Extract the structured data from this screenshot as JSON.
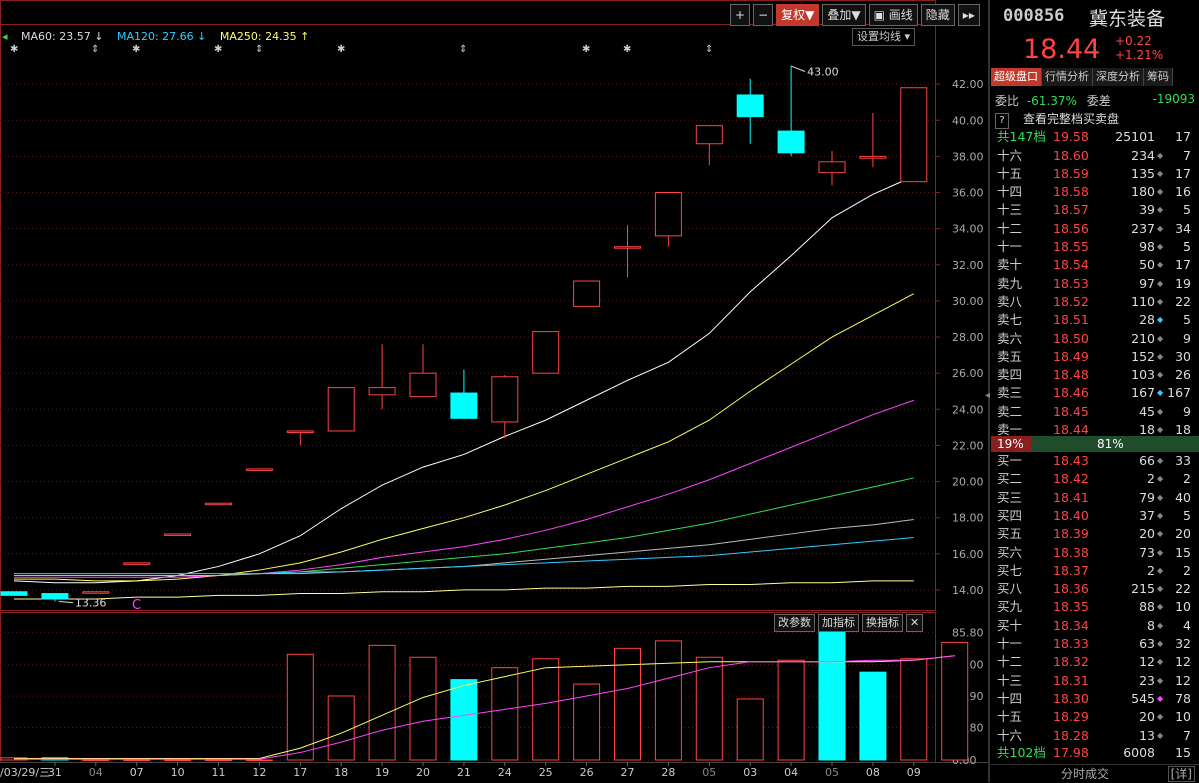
{
  "toolbar": {
    "plus": "+",
    "minus": "−",
    "fuquan": "复权▼",
    "diejia": "叠加▼",
    "draw": "画线",
    "hide": "隐藏",
    "expand": "▸▸"
  },
  "ma_legend": [
    {
      "label": "MA60: 23.57",
      "arrow": "↓",
      "color": "#dddddd"
    },
    {
      "label": "MA120: 27.66",
      "arrow": "↓",
      "color": "#33ccff"
    },
    {
      "label": "MA250: 24.35",
      "arrow": "↑",
      "color": "#ffff66"
    }
  ],
  "set_ma_button": "设置均线",
  "sub_buttons": {
    "params": "改参数",
    "add": "加指标",
    "switch": "换指标",
    "close": "✕"
  },
  "colors": {
    "up": "#ff4444",
    "down": "#00ffff",
    "bg": "#000000",
    "accent": "#c0392b"
  },
  "chart_data": [
    {
      "type": "candlestick",
      "ylim": [
        13.0,
        44.0
      ],
      "y_ticks": [
        "42.00",
        "40.00",
        "38.00",
        "36.00",
        "34.00",
        "32.00",
        "30.00",
        "28.00",
        "26.00",
        "24.00",
        "22.00",
        "20.00",
        "18.00",
        "16.00",
        "14.00"
      ],
      "x_ticks": [
        "/03/29/三",
        "31",
        "04",
        "07",
        "10",
        "11",
        "12",
        "17",
        "18",
        "19",
        "20",
        "21",
        "24",
        "25",
        "26",
        "27",
        "28",
        "05",
        "03",
        "04",
        "05",
        "08",
        "09"
      ],
      "annotations": {
        "high_label": "43.00",
        "low_label": "13.36",
        "marker": "Č"
      },
      "candles": [
        {
          "o": 13.9,
          "h": 13.9,
          "l": 13.7,
          "c": 13.7
        },
        {
          "o": 13.8,
          "h": 13.8,
          "l": 13.36,
          "c": 13.5
        },
        {
          "o": 13.9,
          "h": 13.9,
          "l": 13.9,
          "c": 13.9
        },
        {
          "o": 15.5,
          "h": 15.5,
          "l": 15.5,
          "c": 15.5
        },
        {
          "o": 17.1,
          "h": 17.1,
          "l": 17.1,
          "c": 17.1
        },
        {
          "o": 18.8,
          "h": 18.8,
          "l": 18.8,
          "c": 18.8
        },
        {
          "o": 20.7,
          "h": 20.7,
          "l": 20.7,
          "c": 20.7
        },
        {
          "o": 22.8,
          "h": 22.8,
          "l": 22.0,
          "c": 22.8
        },
        {
          "o": 22.8,
          "h": 25.2,
          "l": 22.8,
          "c": 25.2
        },
        {
          "o": 24.8,
          "h": 27.6,
          "l": 24.0,
          "c": 25.2
        },
        {
          "o": 24.7,
          "h": 27.6,
          "l": 24.7,
          "c": 26.0
        },
        {
          "o": 24.9,
          "h": 26.2,
          "l": 23.5,
          "c": 23.5
        },
        {
          "o": 23.3,
          "h": 25.9,
          "l": 22.4,
          "c": 25.8
        },
        {
          "o": 26.0,
          "h": 28.3,
          "l": 26.0,
          "c": 28.3
        },
        {
          "o": 29.7,
          "h": 31.1,
          "l": 29.7,
          "c": 31.1
        },
        {
          "o": 33.0,
          "h": 34.2,
          "l": 31.3,
          "c": 33.0
        },
        {
          "o": 33.6,
          "h": 36.0,
          "l": 33.0,
          "c": 36.0
        },
        {
          "o": 38.7,
          "h": 39.7,
          "l": 37.5,
          "c": 39.7
        },
        {
          "o": 41.4,
          "h": 42.3,
          "l": 38.7,
          "c": 40.2
        },
        {
          "o": 39.4,
          "h": 43.0,
          "l": 38.0,
          "c": 38.2
        },
        {
          "o": 37.1,
          "h": 38.3,
          "l": 36.4,
          "c": 37.7
        },
        {
          "o": 37.9,
          "h": 40.4,
          "l": 37.4,
          "c": 38.0
        },
        {
          "o": 36.6,
          "h": 41.8,
          "l": 36.6,
          "c": 41.8
        }
      ],
      "ma_series": [
        {
          "color": "#ffffff",
          "values": [
            14.5,
            14.4,
            14.4,
            14.5,
            14.8,
            15.3,
            16.0,
            17.0,
            18.5,
            19.8,
            20.8,
            21.5,
            22.5,
            23.4,
            24.5,
            25.6,
            26.6,
            28.2,
            30.5,
            32.5,
            34.6,
            35.9,
            36.9
          ]
        },
        {
          "color": "#ffff66",
          "values": [
            14.6,
            14.6,
            14.5,
            14.5,
            14.6,
            14.8,
            15.1,
            15.5,
            16.1,
            16.8,
            17.4,
            18.0,
            18.7,
            19.5,
            20.4,
            21.3,
            22.2,
            23.4,
            25.0,
            26.5,
            28.0,
            29.2,
            30.4
          ]
        },
        {
          "color": "#ff44ff",
          "values": [
            14.7,
            14.7,
            14.7,
            14.7,
            14.7,
            14.8,
            14.9,
            15.1,
            15.4,
            15.8,
            16.1,
            16.4,
            16.8,
            17.3,
            17.9,
            18.6,
            19.3,
            20.1,
            21.0,
            21.9,
            22.8,
            23.7,
            24.5
          ]
        },
        {
          "color": "#33dd55",
          "values": [
            14.8,
            14.8,
            14.8,
            14.8,
            14.8,
            14.8,
            14.9,
            15.0,
            15.2,
            15.4,
            15.6,
            15.8,
            16.0,
            16.3,
            16.6,
            16.9,
            17.3,
            17.7,
            18.2,
            18.7,
            19.2,
            19.7,
            20.2
          ]
        },
        {
          "color": "#bbbbbb",
          "values": [
            14.8,
            14.8,
            14.8,
            14.8,
            14.8,
            14.8,
            14.9,
            14.9,
            15.0,
            15.1,
            15.2,
            15.3,
            15.5,
            15.7,
            15.9,
            16.1,
            16.3,
            16.5,
            16.8,
            17.1,
            17.4,
            17.6,
            17.9
          ]
        },
        {
          "color": "#33ccff",
          "values": [
            14.9,
            14.9,
            14.9,
            14.9,
            14.9,
            14.9,
            14.9,
            15.0,
            15.0,
            15.1,
            15.2,
            15.3,
            15.4,
            15.5,
            15.6,
            15.7,
            15.8,
            15.9,
            16.1,
            16.3,
            16.5,
            16.7,
            16.9
          ]
        },
        {
          "color": "#ffff99",
          "values": [
            13.5,
            13.5,
            13.5,
            13.6,
            13.6,
            13.7,
            13.7,
            13.8,
            13.8,
            13.9,
            13.9,
            14.0,
            14.0,
            14.1,
            14.1,
            14.2,
            14.2,
            14.3,
            14.3,
            14.4,
            14.4,
            14.5,
            14.5
          ]
        }
      ]
    },
    {
      "type": "bar",
      "ylim": [
        0,
        90
      ],
      "y_ticks": [
        "85.80",
        "64.00",
        "42.90",
        "21.80",
        "0.00"
      ],
      "values": [
        1.5,
        1.5,
        0,
        0,
        0,
        0,
        0,
        71,
        43,
        77,
        69,
        54,
        62,
        68,
        51,
        75,
        80,
        69,
        41,
        67,
        88,
        59,
        68,
        79
      ],
      "up": [
        true,
        false,
        true,
        true,
        true,
        true,
        true,
        true,
        true,
        true,
        true,
        false,
        true,
        true,
        true,
        true,
        true,
        true,
        true,
        true,
        false,
        false,
        true,
        true
      ],
      "lines": [
        {
          "color": "#ffff66",
          "values": [
            1,
            1,
            1,
            1,
            1,
            1,
            1,
            8,
            18,
            30,
            42,
            50,
            56,
            62,
            63,
            64,
            65,
            66,
            66,
            66,
            66,
            66,
            67,
            70
          ]
        },
        {
          "color": "#ff44ff",
          "values": [
            0.5,
            0.5,
            0.5,
            0.5,
            0.5,
            0.5,
            0.5,
            5,
            12,
            20,
            26,
            30,
            34,
            38,
            43,
            48,
            55,
            62,
            66,
            66,
            66,
            67,
            67,
            70
          ]
        }
      ]
    }
  ],
  "quote": {
    "code": "000856",
    "name": "冀东装备",
    "price": "18.44",
    "change": "+0.22",
    "change_pct": "+1.21%"
  },
  "tabs": [
    "超级盘口",
    "行情分析",
    "深度分析",
    "筹码"
  ],
  "weibi": {
    "label1": "委比",
    "val1": "-61.37%",
    "label2": "委差",
    "val2": "-19093"
  },
  "full_book_label": "查看完整档买卖盘",
  "sell_total": {
    "label": "共147档",
    "price": "19.58",
    "vol": "25101",
    "cnt": "17"
  },
  "asks": [
    {
      "lbl": "十六",
      "pr": "18.60",
      "vol": "234",
      "mk": "◆",
      "cnt": "7",
      "mkc": "#888888"
    },
    {
      "lbl": "十五",
      "pr": "18.59",
      "vol": "135",
      "mk": "◆",
      "cnt": "17",
      "mkc": "#888888"
    },
    {
      "lbl": "十四",
      "pr": "18.58",
      "vol": "180",
      "mk": "◆",
      "cnt": "16",
      "mkc": "#888888"
    },
    {
      "lbl": "十三",
      "pr": "18.57",
      "vol": "39",
      "mk": "◆",
      "cnt": "5",
      "mkc": "#888888"
    },
    {
      "lbl": "十二",
      "pr": "18.56",
      "vol": "237",
      "mk": "◆",
      "cnt": "34",
      "mkc": "#888888"
    },
    {
      "lbl": "十一",
      "pr": "18.55",
      "vol": "98",
      "mk": "◆",
      "cnt": "5",
      "mkc": "#888888"
    },
    {
      "lbl": "卖十",
      "pr": "18.54",
      "vol": "50",
      "mk": "◆",
      "cnt": "17",
      "mkc": "#888888"
    },
    {
      "lbl": "卖九",
      "pr": "18.53",
      "vol": "97",
      "mk": "◆",
      "cnt": "19",
      "mkc": "#888888"
    },
    {
      "lbl": "卖八",
      "pr": "18.52",
      "vol": "110",
      "mk": "◆",
      "cnt": "22",
      "mkc": "#888888"
    },
    {
      "lbl": "卖七",
      "pr": "18.51",
      "vol": "28",
      "mk": "◆",
      "cnt": "5",
      "mkc": "#33ccff"
    },
    {
      "lbl": "卖六",
      "pr": "18.50",
      "vol": "210",
      "mk": "◆",
      "cnt": "9",
      "mkc": "#888888"
    },
    {
      "lbl": "卖五",
      "pr": "18.49",
      "vol": "152",
      "mk": "◆",
      "cnt": "30",
      "mkc": "#888888"
    },
    {
      "lbl": "卖四",
      "pr": "18.48",
      "vol": "103",
      "mk": "◆",
      "cnt": "26",
      "mkc": "#888888"
    },
    {
      "lbl": "卖三",
      "pr": "18.46",
      "vol": "167",
      "mk": "◆",
      "cnt": "167",
      "mkc": "#33ccff"
    },
    {
      "lbl": "卖二",
      "pr": "18.45",
      "vol": "45",
      "mk": "◆",
      "cnt": "9",
      "mkc": "#888888"
    },
    {
      "lbl": "卖一",
      "pr": "18.44",
      "vol": "18",
      "mk": "◆",
      "cnt": "18",
      "mkc": "#888888"
    }
  ],
  "ratio": {
    "left": "19%",
    "right": "81%"
  },
  "bids": [
    {
      "lbl": "买一",
      "pr": "18.43",
      "vol": "66",
      "mk": "◆",
      "cnt": "33",
      "mkc": "#888888"
    },
    {
      "lbl": "买二",
      "pr": "18.42",
      "vol": "2",
      "mk": "◆",
      "cnt": "2",
      "mkc": "#888888"
    },
    {
      "lbl": "买三",
      "pr": "18.41",
      "vol": "79",
      "mk": "◆",
      "cnt": "40",
      "mkc": "#888888"
    },
    {
      "lbl": "买四",
      "pr": "18.40",
      "vol": "37",
      "mk": "◆",
      "cnt": "5",
      "mkc": "#888888"
    },
    {
      "lbl": "买五",
      "pr": "18.39",
      "vol": "20",
      "mk": "◆",
      "cnt": "20",
      "mkc": "#888888"
    },
    {
      "lbl": "买六",
      "pr": "18.38",
      "vol": "73",
      "mk": "◆",
      "cnt": "15",
      "mkc": "#888888"
    },
    {
      "lbl": "买七",
      "pr": "18.37",
      "vol": "2",
      "mk": "◆",
      "cnt": "2",
      "mkc": "#888888"
    },
    {
      "lbl": "买八",
      "pr": "18.36",
      "vol": "215",
      "mk": "◆",
      "cnt": "22",
      "mkc": "#888888"
    },
    {
      "lbl": "买九",
      "pr": "18.35",
      "vol": "88",
      "mk": "◆",
      "cnt": "10",
      "mkc": "#888888"
    },
    {
      "lbl": "买十",
      "pr": "18.34",
      "vol": "8",
      "mk": "◆",
      "cnt": "4",
      "mkc": "#888888"
    },
    {
      "lbl": "十一",
      "pr": "18.33",
      "vol": "63",
      "mk": "◆",
      "cnt": "32",
      "mkc": "#888888"
    },
    {
      "lbl": "十二",
      "pr": "18.32",
      "vol": "12",
      "mk": "◆",
      "cnt": "12",
      "mkc": "#888888"
    },
    {
      "lbl": "十三",
      "pr": "18.31",
      "vol": "23",
      "mk": "◆",
      "cnt": "12",
      "mkc": "#888888"
    },
    {
      "lbl": "十四",
      "pr": "18.30",
      "vol": "545",
      "mk": "◆",
      "cnt": "78",
      "mkc": "#ff44ff"
    },
    {
      "lbl": "十五",
      "pr": "18.29",
      "vol": "20",
      "mk": "◆",
      "cnt": "10",
      "mkc": "#888888"
    },
    {
      "lbl": "十六",
      "pr": "18.28",
      "vol": "13",
      "mk": "◆",
      "cnt": "7",
      "mkc": "#888888"
    }
  ],
  "buy_total": {
    "label": "共102档",
    "price": "17.98",
    "vol": "6008",
    "cnt": "15"
  },
  "bottom": {
    "label": "分时成交",
    "detail": "[详]"
  }
}
